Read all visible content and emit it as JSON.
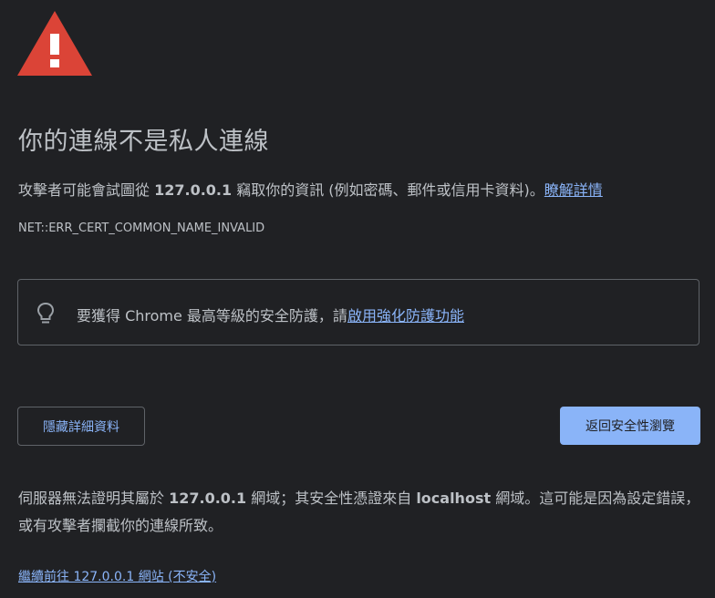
{
  "icons": {
    "warning": "warning-triangle-icon",
    "bulb": "lightbulb-icon"
  },
  "colors": {
    "background": "#202124",
    "text": "#bdc1c6",
    "link": "#8ab4f8",
    "warning_red": "#db4437",
    "border": "#5f6368"
  },
  "heading": "你的連線不是私人連線",
  "desc": {
    "pre": "攻擊者可能會試圖從 ",
    "host": "127.0.0.1",
    "post": " 竊取你的資訊 (例如密碼、郵件或信用卡資料)。",
    "learn_more": "瞭解詳情"
  },
  "error_code": "NET::ERR_CERT_COMMON_NAME_INVALID",
  "enhanced": {
    "text": "要獲得 Chrome 最高等級的安全防護，請",
    "link": "啟用強化防護功能"
  },
  "buttons": {
    "hide_details": "隱藏詳細資料",
    "back_to_safety": "返回安全性瀏覽"
  },
  "details": {
    "p1": "伺服器無法證明其屬於 ",
    "host": "127.0.0.1",
    "p2": " 網域；其安全性憑證來自 ",
    "cert_host": "localhost",
    "p3": " 網域。這可能是因為設定錯誤，或有攻擊者攔截你的連線所致。"
  },
  "proceed_link": "繼續前往 127.0.0.1 網站 (不安全)"
}
